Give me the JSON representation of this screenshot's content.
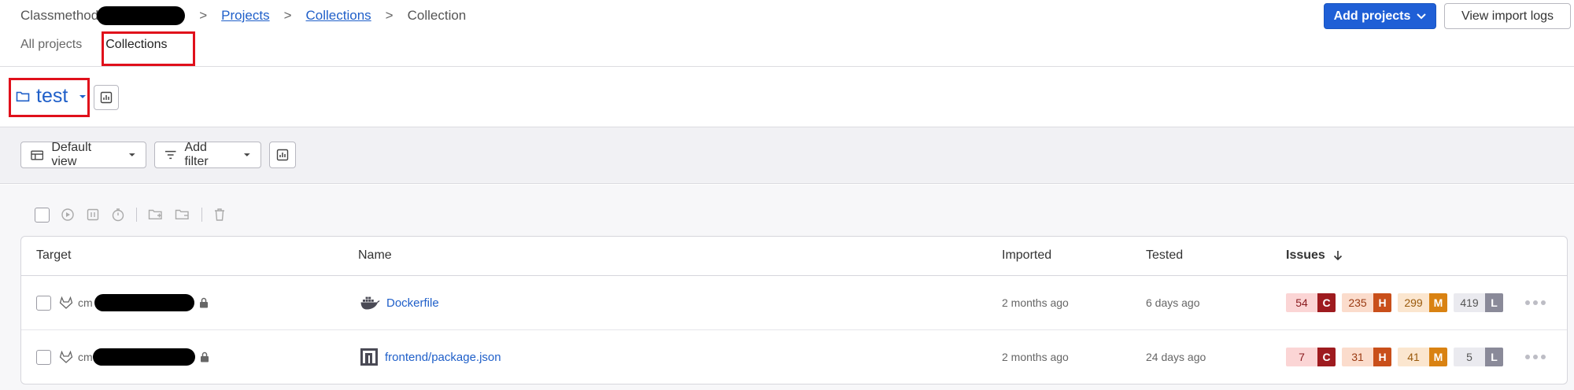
{
  "breadcrumb": {
    "org": "Classmethod",
    "projects": "Projects",
    "collections": "Collections",
    "current": "Collection",
    "separator": ">"
  },
  "header": {
    "add_projects": "Add projects",
    "view_import_logs": "View import logs"
  },
  "tabs": [
    {
      "label": "All projects",
      "active": false
    },
    {
      "label": "Collections",
      "active": true
    }
  ],
  "collection": {
    "name": "test",
    "icon": "folder-icon"
  },
  "filters": {
    "view": "Default view",
    "add_filter": "Add filter"
  },
  "table": {
    "columns": {
      "target": "Target",
      "name": "Name",
      "imported": "Imported",
      "tested": "Tested",
      "issues": "Issues"
    },
    "rows": [
      {
        "target_prefix": "cm",
        "name": "Dockerfile",
        "icon": "docker-icon",
        "imported": "2 months ago",
        "tested": "6 days ago",
        "critical": "54",
        "high": "235",
        "medium": "299",
        "low": "419"
      },
      {
        "target_prefix": "cm",
        "name": "frontend/package.json",
        "icon": "npm-icon",
        "imported": "2 months ago",
        "tested": "24 days ago",
        "critical": "7",
        "high": "31",
        "medium": "41",
        "low": "5"
      }
    ]
  },
  "severity": {
    "critical_letter": "C",
    "high_letter": "H",
    "medium_letter": "M",
    "low_letter": "L"
  },
  "colors": {
    "primary": "#1f5fd6",
    "link": "#1f5fc9",
    "highlight": "#e0101b",
    "critical": "#9e1b1f",
    "critical_bg": "#fbd5d5",
    "high": "#c94f1a",
    "high_bg": "#fbdccc",
    "medium": "#d98212",
    "medium_bg": "#fbe6cf",
    "low": "#8a8a99",
    "low_bg": "#eaeaef"
  }
}
